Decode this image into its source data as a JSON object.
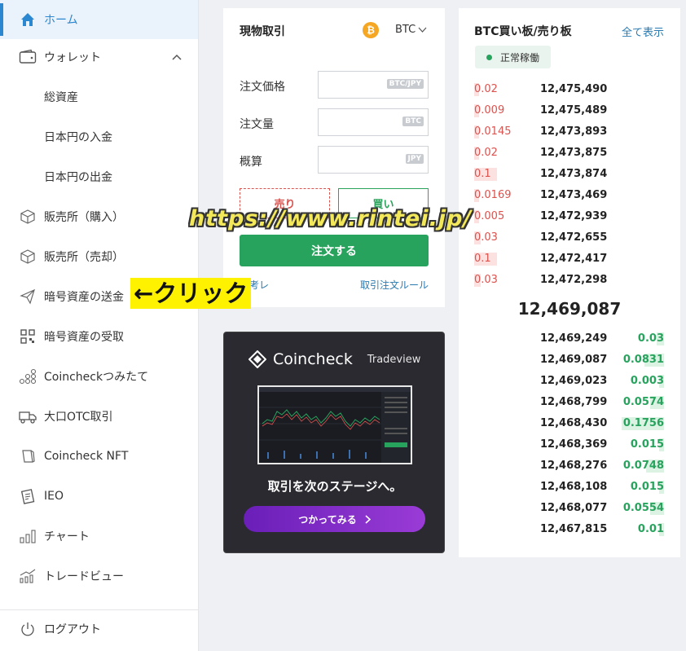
{
  "sidebar": {
    "items": [
      {
        "label": "ホーム",
        "icon": "home-icon"
      },
      {
        "label": "ウォレット",
        "icon": "wallet-icon"
      },
      {
        "label": "総資産"
      },
      {
        "label": "日本円の入金"
      },
      {
        "label": "日本円の出金"
      },
      {
        "label": "販売所（購入）",
        "icon": "cube-icon"
      },
      {
        "label": "販売所（売却）",
        "icon": "cube-icon"
      },
      {
        "label": "暗号資産の送金",
        "icon": "paper-plane-icon"
      },
      {
        "label": "暗号資産の受取",
        "icon": "qr-code-icon"
      },
      {
        "label": "Coincheckつみたて",
        "icon": "coin-stack-icon"
      },
      {
        "label": "大口OTC取引",
        "icon": "truck-icon"
      },
      {
        "label": "Coincheck NFT",
        "icon": "nft-card-icon"
      },
      {
        "label": "IEO",
        "icon": "ieo-icon"
      },
      {
        "label": "チャート",
        "icon": "bar-chart-icon"
      },
      {
        "label": "トレードビュー",
        "icon": "trend-chart-icon"
      }
    ],
    "logout": {
      "label": "ログアウト",
      "icon": "power-icon"
    }
  },
  "trade": {
    "title": "現物取引",
    "pair": "BTC",
    "coin_symbol": "₿",
    "price_label": "注文価格",
    "price_unit": "BTC/JPY",
    "amount_label": "注文量",
    "amount_unit": "BTC",
    "estimate_label": "概算",
    "estimate_unit": "JPY",
    "sell_label": "売り",
    "buy_label": "買い",
    "order_label": "注文する",
    "ref_link": "参考レ",
    "rule_link": "取引注文ルール"
  },
  "banner": {
    "brand": "Coincheck",
    "product": "Tradeview",
    "title": "取引を次のステージへ。",
    "cta": "つかってみる"
  },
  "book": {
    "title": "BTC買い板/売り板",
    "show_all": "全て表示",
    "status": "正常稼働",
    "asks": [
      {
        "qty": "0.02",
        "price": "12,475,490",
        "fill": 0.14
      },
      {
        "qty": "0.009",
        "price": "12,475,489",
        "fill": 0.06
      },
      {
        "qty": "0.0145",
        "price": "12,473,893",
        "fill": 0.1
      },
      {
        "qty": "0.02",
        "price": "12,473,875",
        "fill": 0.14
      },
      {
        "qty": "0.1",
        "price": "12,473,874",
        "fill": 0.7
      },
      {
        "qty": "0.0169",
        "price": "12,473,469",
        "fill": 0.12
      },
      {
        "qty": "0.005",
        "price": "12,472,939",
        "fill": 0.04
      },
      {
        "qty": "0.03",
        "price": "12,472,655",
        "fill": 0.21
      },
      {
        "qty": "0.1",
        "price": "12,472,417",
        "fill": 0.7
      },
      {
        "qty": "0.03",
        "price": "12,472,298",
        "fill": 0.21
      }
    ],
    "mid_price": "12,469,087",
    "bids": [
      {
        "qty": "0.03",
        "price": "12,469,249",
        "fill": 0.17
      },
      {
        "qty": "0.0831",
        "price": "12,469,087",
        "fill": 0.47
      },
      {
        "qty": "0.003",
        "price": "12,469,023",
        "fill": 0.02
      },
      {
        "qty": "0.0574",
        "price": "12,468,799",
        "fill": 0.33
      },
      {
        "qty": "0.1756",
        "price": "12,468,430",
        "fill": 1.0
      },
      {
        "qty": "0.015",
        "price": "12,468,369",
        "fill": 0.09
      },
      {
        "qty": "0.0748",
        "price": "12,468,276",
        "fill": 0.43
      },
      {
        "qty": "0.015",
        "price": "12,468,108",
        "fill": 0.09
      },
      {
        "qty": "0.0554",
        "price": "12,468,077",
        "fill": 0.32
      },
      {
        "qty": "0.01",
        "price": "12,467,815",
        "fill": 0.06
      }
    ]
  },
  "overlay": {
    "url": "https://www.rintei.jp/",
    "click": "←クリック"
  },
  "colors": {
    "accent": "#2a87d0",
    "buy": "#27a35d",
    "sell": "#d9534f",
    "btc": "#f5a623"
  }
}
